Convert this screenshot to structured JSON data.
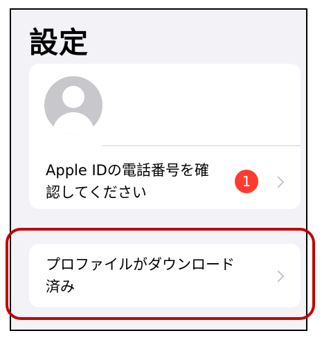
{
  "header": {
    "title": "設定"
  },
  "account": {
    "avatar_icon": "person-silhouette-icon",
    "row_label": "Apple IDの電話番号を確\n認してください",
    "badge_count": "1",
    "chevron_icon": "chevron-right-icon"
  },
  "profile": {
    "row_label": "プロファイルがダウンロード\n済み",
    "chevron_icon": "chevron-right-icon"
  },
  "annotation": {
    "highlight_color": "#c00000"
  },
  "colors": {
    "background": "#f2f2f7",
    "card": "#ffffff",
    "badge": "#ff3b30",
    "chevron": "#c4c4c7"
  }
}
